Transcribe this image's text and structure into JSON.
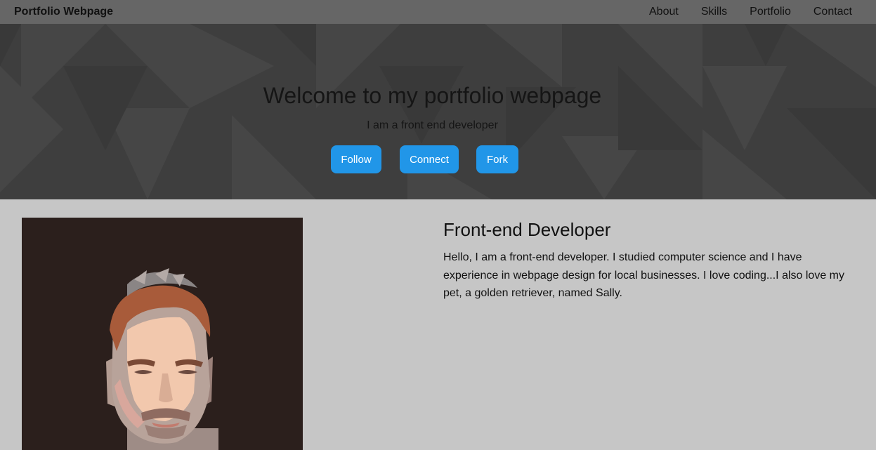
{
  "navbar": {
    "brand": "Portfolio Webpage",
    "links": [
      {
        "label": "About"
      },
      {
        "label": "Skills"
      },
      {
        "label": "Portfolio"
      },
      {
        "label": "Contact"
      }
    ]
  },
  "hero": {
    "title": "Welcome to my portfolio webpage",
    "subtitle": "I am a front end developer",
    "buttons": [
      {
        "label": "Follow"
      },
      {
        "label": "Connect"
      },
      {
        "label": "Fork"
      }
    ]
  },
  "about": {
    "heading": "Front-end Developer",
    "text": "Hello, I am a front-end developer. I studied computer science and I have experience in webpage design for local businesses. I love coding...I also love my pet, a golden retriever, named Sally."
  },
  "colors": {
    "navbar_bg": "#666666",
    "hero_bg": "#3f3f3f",
    "button_bg": "#2196e8",
    "page_bg": "#c6c6c6",
    "photo_bg": "#2b1f1c"
  }
}
